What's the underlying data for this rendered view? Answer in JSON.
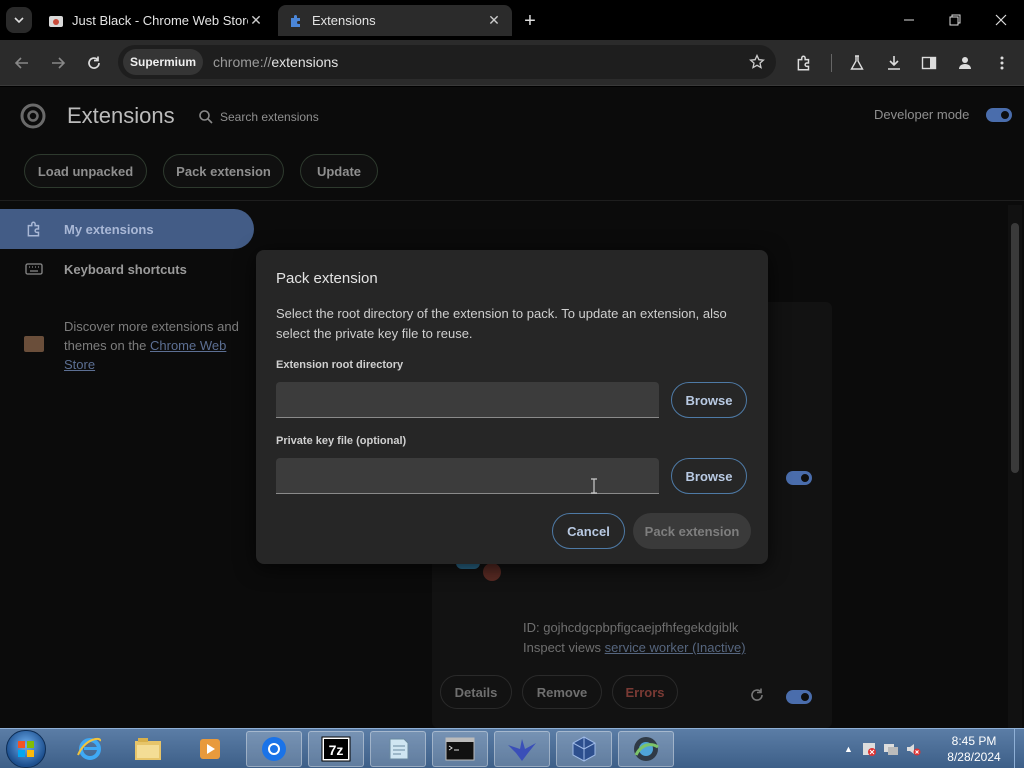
{
  "browser": {
    "tabs": [
      {
        "title": "Just Black - Chrome Web Store",
        "active": false
      },
      {
        "title": "Extensions",
        "active": true
      }
    ],
    "chip_label": "Supermium",
    "url_scheme": "chrome://",
    "url_path": "extensions"
  },
  "page": {
    "title": "Extensions",
    "search_placeholder": "Search extensions",
    "developer_mode_label": "Developer mode",
    "developer_mode_on": true,
    "buttons": {
      "load_unpacked": "Load unpacked",
      "pack_extension": "Pack extension",
      "update": "Update"
    },
    "sidebar": {
      "my_extensions": "My extensions",
      "keyboard_shortcuts": "Keyboard shortcuts",
      "discover_text": "Discover more extensions and themes on the ",
      "discover_link": "Chrome Web Store"
    },
    "card": {
      "id_line": "ID: gojhcdgcpbpfigcaejpfhfegekdgiblk",
      "inspect_label": "Inspect views ",
      "inspect_link": "service worker (Inactive)",
      "details": "Details",
      "remove": "Remove",
      "errors": "Errors"
    }
  },
  "dialog": {
    "title": "Pack extension",
    "description": "Select the root directory of the extension to pack. To update an extension, also select the private key file to reuse.",
    "root_label": "Extension root directory",
    "root_value": "",
    "key_label": "Private key file (optional)",
    "key_value": "",
    "browse": "Browse",
    "cancel": "Cancel",
    "pack": "Pack extension"
  },
  "taskbar": {
    "time": "8:45 PM",
    "date": "8/28/2024"
  },
  "colors": {
    "accent": "#4a6dac",
    "dialog_bg": "#262626",
    "button_border": "#4e7aa6"
  }
}
